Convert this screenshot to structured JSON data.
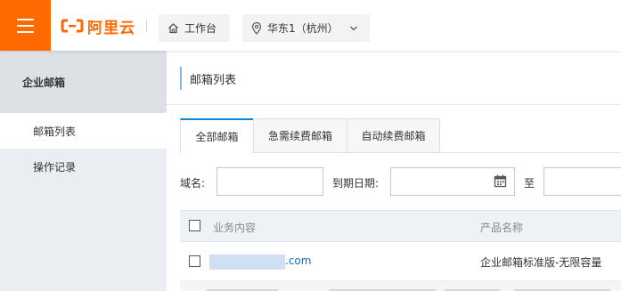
{
  "topbar": {
    "logo_text": "阿里云",
    "workbench_label": "工作台",
    "region_label": "华东1（杭州）",
    "accent_color": "#ff6a00"
  },
  "sidebar": {
    "header": "企业邮箱",
    "items": [
      {
        "label": "邮箱列表",
        "active": true
      },
      {
        "label": "操作记录",
        "active": false
      }
    ]
  },
  "main": {
    "page_title": "邮箱列表",
    "tabs": [
      {
        "label": "全部邮箱",
        "active": true
      },
      {
        "label": "急需续费邮箱",
        "active": false
      },
      {
        "label": "自动续费邮箱",
        "active": false
      }
    ],
    "filters": {
      "domain_label": "域名:",
      "domain_value": "",
      "expiry_label": "到期日期:",
      "expiry_start": "",
      "to_label": "至",
      "expiry_end": ""
    },
    "table": {
      "columns": [
        "业务内容",
        "产品名称"
      ],
      "rows": [
        {
          "domain_suffix": ".com",
          "product": "企业邮箱标准版-无限容量"
        }
      ]
    }
  },
  "icons": {
    "menu": "hamburger-menu-icon",
    "home": "home-icon",
    "location": "location-pin-icon",
    "chevron": "chevron-down-icon",
    "calendar": "calendar-icon"
  }
}
